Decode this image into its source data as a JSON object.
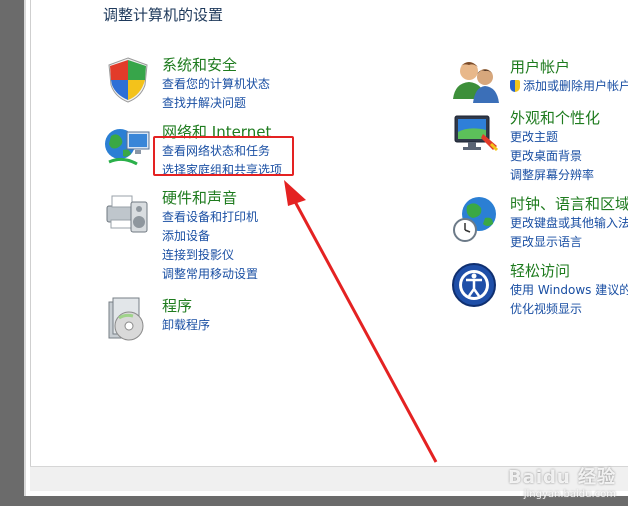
{
  "page_title": "调整计算机的设置",
  "categories": [
    {
      "title": "系统和安全",
      "links": [
        "查看您的计算机状态",
        "查找并解决问题"
      ],
      "icon": "shield-icon"
    },
    {
      "title": "网络和 Internet",
      "links": [
        "查看网络状态和任务",
        "选择家庭组和共享选项"
      ],
      "icon": "network-icon"
    },
    {
      "title": "硬件和声音",
      "links": [
        "查看设备和打印机",
        "添加设备",
        "连接到投影仪",
        "调整常用移动设置"
      ],
      "icon": "printer-icon"
    },
    {
      "title": "程序",
      "links": [
        "卸载程序"
      ],
      "icon": "programs-icon"
    },
    {
      "title": "用户帐户",
      "links": [
        "添加或删除用户帐户"
      ],
      "icon": "users-icon"
    },
    {
      "title": "外观和个性化",
      "links": [
        "更改主题",
        "更改桌面背景",
        "调整屏幕分辨率"
      ],
      "icon": "monitor-icon"
    },
    {
      "title": "时钟、语言和区域",
      "links": [
        "更改键盘或其他输入法",
        "更改显示语言"
      ],
      "icon": "clock-globe-icon"
    },
    {
      "title": "轻松访问",
      "links": [
        "使用 Windows 建议的设置",
        "优化视频显示"
      ],
      "icon": "accessibility-icon"
    }
  ],
  "annotation": {
    "highlight_color": "#e42222"
  },
  "watermark": {
    "brand": "Baidu 经验",
    "sub": "jingyan.baidu.com"
  }
}
